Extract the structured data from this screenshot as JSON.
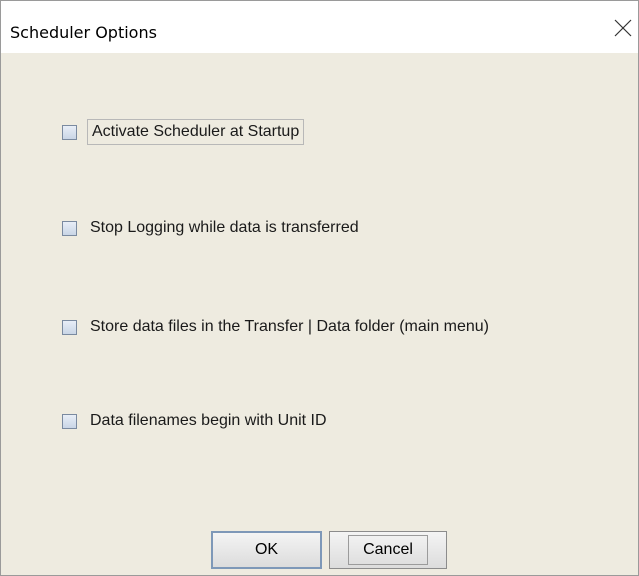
{
  "dialog": {
    "title": "Scheduler Options"
  },
  "options": [
    {
      "label": "Activate Scheduler at Startup",
      "checked": false
    },
    {
      "label": "Stop Logging while data is transferred",
      "checked": false
    },
    {
      "label": "Store data files in the Transfer | Data folder (main menu)",
      "checked": false
    },
    {
      "label": "Data filenames begin with Unit ID",
      "checked": false
    }
  ],
  "buttons": {
    "ok_label": "OK",
    "cancel_label": "Cancel"
  },
  "icons": {
    "close": "close-icon"
  },
  "colors": {
    "dialog_background": "#eeebe0",
    "titlebar_background": "#ffffff"
  }
}
